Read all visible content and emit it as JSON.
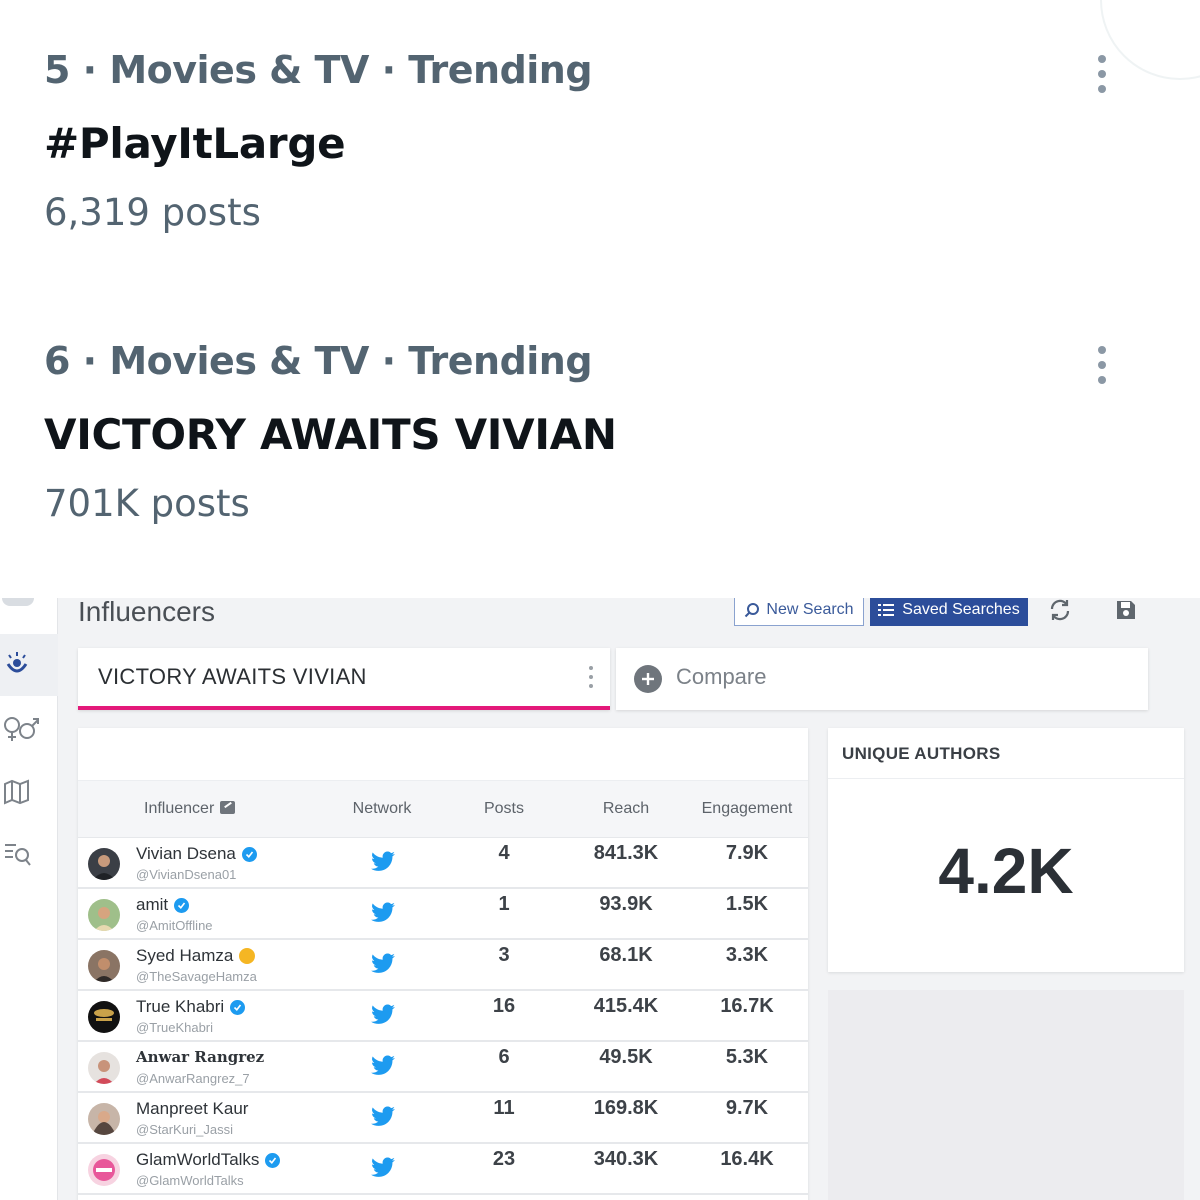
{
  "trends": [
    {
      "meta": "5 · Movies & TV · Trending",
      "name": "#PlayItLarge",
      "posts": "6,319 posts"
    },
    {
      "meta": "6 · Movies & TV · Trending",
      "name": "VICTORY AWAITS VIVIAN",
      "posts": "701K posts"
    }
  ],
  "dashboard": {
    "title": "Influencers",
    "new_search_label": "New Search",
    "saved_searches_label": "Saved Searches",
    "search_tab_label": "VICTORY AWAITS VIVIAN",
    "compare_label": "Compare",
    "accent_color": "#e3197a",
    "primary_color": "#2c4d9a",
    "table": {
      "headers": {
        "influencer": "Influencer",
        "network": "Network",
        "posts": "Posts",
        "reach": "Reach",
        "engagement": "Engagement"
      },
      "rows": [
        {
          "name": "Vivian Dsena",
          "handle": "@VivianDsena01",
          "verified": true,
          "network": "twitter-icon",
          "posts": "4",
          "reach": "841.3K",
          "engagement": "7.9K"
        },
        {
          "name": "amit",
          "handle": "@AmitOffline",
          "verified": true,
          "network": "twitter-icon",
          "posts": "1",
          "reach": "93.9K",
          "engagement": "1.5K"
        },
        {
          "name": "Syed Hamza",
          "handle": "@TheSavageHamza",
          "verified": false,
          "badge": "emoji-icon",
          "network": "twitter-icon",
          "posts": "3",
          "reach": "68.1K",
          "engagement": "3.3K"
        },
        {
          "name": "True Khabri",
          "handle": "@TrueKhabri",
          "verified": true,
          "network": "twitter-icon",
          "posts": "16",
          "reach": "415.4K",
          "engagement": "16.7K"
        },
        {
          "name": "Anwar Rangrez",
          "handle": "@AnwarRangrez_7",
          "verified": false,
          "network": "twitter-icon",
          "posts": "6",
          "reach": "49.5K",
          "engagement": "5.3K"
        },
        {
          "name": "Manpreet Kaur",
          "handle": "@StarKuri_Jassi",
          "verified": false,
          "network": "twitter-icon",
          "posts": "11",
          "reach": "169.8K",
          "engagement": "9.7K"
        },
        {
          "name": "GlamWorldTalks",
          "handle": "@GlamWorldTalks",
          "verified": true,
          "network": "twitter-icon",
          "posts": "23",
          "reach": "340.3K",
          "engagement": "16.4K"
        }
      ]
    },
    "unique_authors": {
      "title": "UNIQUE AUTHORS",
      "value": "4.2K"
    }
  }
}
